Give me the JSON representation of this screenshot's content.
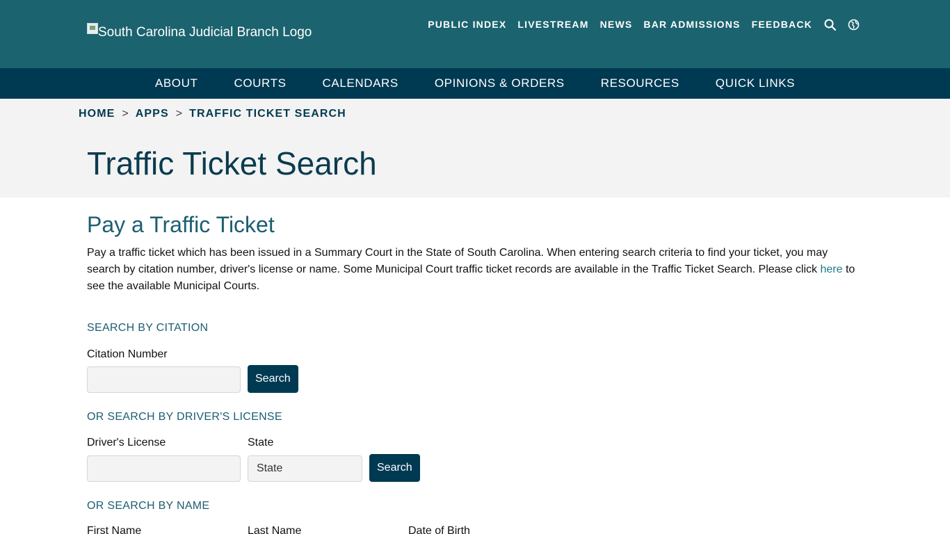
{
  "header": {
    "logo_alt": "South Carolina Judicial Branch Logo",
    "utility_links": [
      "PUBLIC INDEX",
      "LIVESTREAM",
      "NEWS",
      "BAR ADMISSIONS",
      "FEEDBACK"
    ],
    "search_icon": "search-icon",
    "language_icon": "globe-icon"
  },
  "nav": {
    "items": [
      "ABOUT",
      "COURTS",
      "CALENDARS",
      "OPINIONS & ORDERS",
      "RESOURCES",
      "QUICK LINKS"
    ]
  },
  "breadcrumb": {
    "items": [
      "HOME",
      "APPS",
      "TRAFFIC TICKET SEARCH"
    ],
    "separator": ">"
  },
  "page_title": "Traffic Ticket Search",
  "section": {
    "title": "Pay a Traffic Ticket",
    "intro_before": "Pay a traffic ticket which has been issued in a Summary Court in the State of South Carolina. When entering search criteria to find your ticket, you may search by citation number, driver's license or name. Some Municipal Court traffic ticket records are available in the Traffic Ticket Search.  Please click ",
    "intro_link": "here",
    "intro_after": " to see the available Municipal Courts."
  },
  "citation": {
    "heading": "SEARCH BY CITATION",
    "label": "Citation Number",
    "value": "",
    "button": "Search"
  },
  "license": {
    "heading": "OR SEARCH BY DRIVER'S LICENSE",
    "license_label": "Driver's License",
    "license_value": "",
    "state_label": "State",
    "state_value": "State",
    "button": "Search"
  },
  "name": {
    "heading": "OR SEARCH BY NAME",
    "first_label": "First Name",
    "last_label": "Last Name",
    "dob_label": "Date of Birth"
  }
}
